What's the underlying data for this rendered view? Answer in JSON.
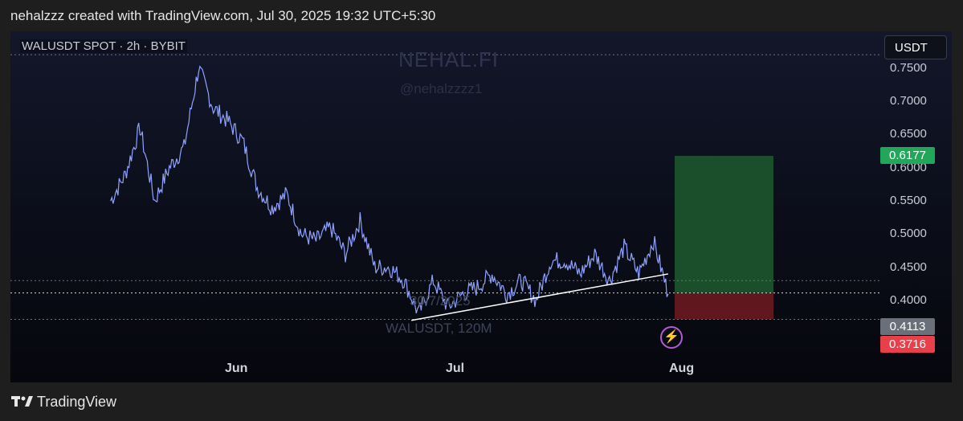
{
  "header": {
    "credit": "nehalzzz created with TradingView.com, Jul 30, 2025 19:32 UTC+5:30"
  },
  "chart_data": {
    "type": "line",
    "title": "WALUSDT SPOT · 2h · BYBIT",
    "xlabel": "",
    "ylabel": "",
    "x_ticks": [
      "Jun",
      "Jul",
      "Aug"
    ],
    "y_ticks": [
      "0.7500",
      "0.7000",
      "0.6500",
      "0.6000",
      "0.5500",
      "0.5000",
      "0.4500",
      "0.4000"
    ],
    "ylim": [
      0.35,
      0.8
    ],
    "grid": false,
    "series": [
      {
        "name": "WALUSDT",
        "x": [
          "May 15",
          "May 17",
          "May 19",
          "May 21",
          "May 23",
          "May 25",
          "May 27",
          "May 29",
          "May 31",
          "Jun 2",
          "Jun 4",
          "Jun 6",
          "Jun 8",
          "Jun 10",
          "Jun 12",
          "Jun 14",
          "Jun 16",
          "Jun 18",
          "Jun 20",
          "Jun 22",
          "Jun 24",
          "Jun 26",
          "Jun 28",
          "Jun 30",
          "Jul 2",
          "Jul 4",
          "Jul 6",
          "Jul 8",
          "Jul 10",
          "Jul 12",
          "Jul 14",
          "Jul 16",
          "Jul 18",
          "Jul 20",
          "Jul 22",
          "Jul 24",
          "Jul 26",
          "Jul 28",
          "Jul 30"
        ],
        "values": [
          0.55,
          0.59,
          0.66,
          0.55,
          0.6,
          0.63,
          0.75,
          0.69,
          0.67,
          0.64,
          0.57,
          0.54,
          0.56,
          0.5,
          0.49,
          0.51,
          0.47,
          0.52,
          0.45,
          0.45,
          0.43,
          0.38,
          0.43,
          0.39,
          0.41,
          0.42,
          0.44,
          0.41,
          0.43,
          0.4,
          0.46,
          0.46,
          0.44,
          0.47,
          0.43,
          0.48,
          0.44,
          0.49,
          0.41
        ]
      }
    ],
    "trendline": {
      "from": [
        "Jun 25",
        0.37
      ],
      "to": [
        "Jul 30",
        0.44
      ]
    },
    "position": {
      "type": "long",
      "target": 0.6177,
      "entry": 0.4113,
      "stop": 0.3716
    },
    "horizontal_lines": [
      0.77,
      0.43,
      0.4113,
      0.3716
    ],
    "colors": {
      "line": "#8fa2ff",
      "profit_zone": "#1e5a2f",
      "loss_zone": "#6a1820",
      "target_tag": "#21a65a",
      "entry_tag": "#6b6f7a",
      "stop_tag": "#e8404a"
    }
  },
  "watermark": {
    "brand": "NEHAL.FI",
    "handle": "@nehalzzzz1",
    "date": "30/7/2025",
    "pair": "WALUSDT, 120M"
  },
  "price_axis": {
    "currency": "USDT",
    "target_label": "0.6177",
    "entry_label": "0.4113",
    "stop_label": "0.3716"
  },
  "footer": {
    "brand": "TradingView",
    "logo_icon": "tradingview-logo-icon"
  },
  "events": {
    "icon": "lightning-bolt-icon"
  }
}
